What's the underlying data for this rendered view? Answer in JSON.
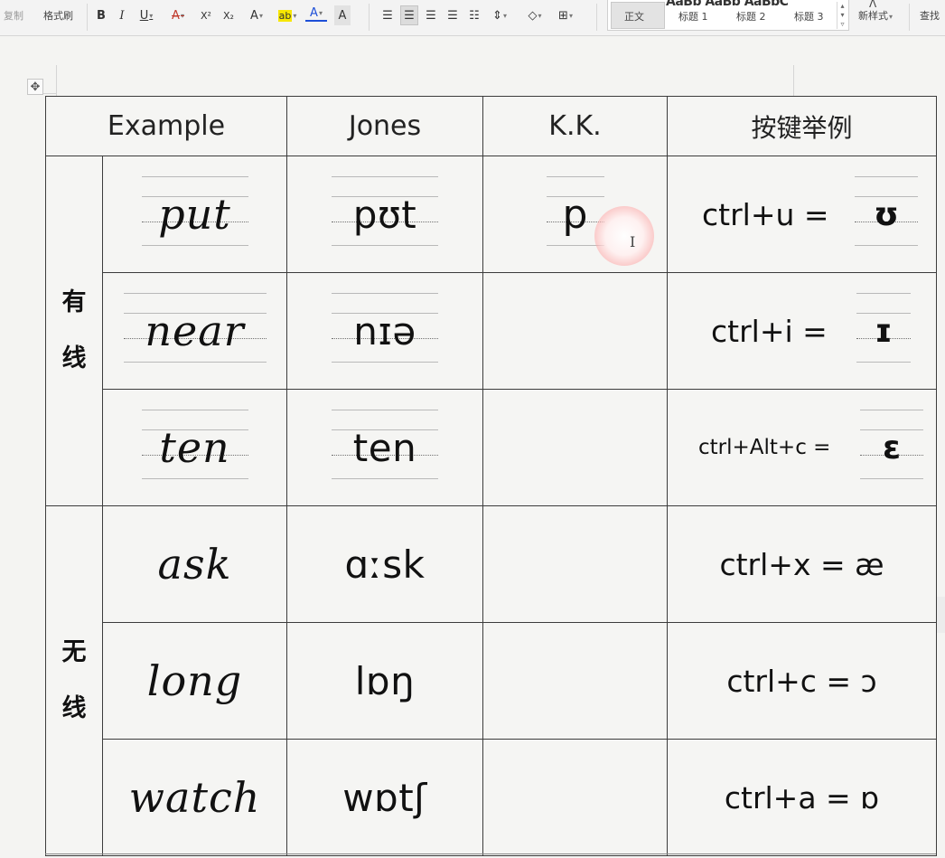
{
  "toolbar": {
    "copy_label": "复制",
    "format_painter_label": "格式刷",
    "bold": "B",
    "italic": "I",
    "underline": "U",
    "strike": "A",
    "superscript": "X²",
    "subscript": "X₂",
    "font_color_a": "A",
    "highlight": "ab",
    "font_color": "A",
    "char_shade": "A",
    "styles": {
      "preview": "AaBb AaBb AaBbC",
      "items": [
        "正文",
        "标题 1",
        "标题 2",
        "标题 3"
      ]
    },
    "new_style_label": "新样式",
    "find_label": "查找"
  },
  "table": {
    "headers": [
      "Example",
      "Jones",
      "K.K.",
      "按键举例"
    ],
    "groups": [
      {
        "label_chars": [
          "有",
          "线"
        ],
        "rows": [
          {
            "example": "put",
            "jones": "pʊt",
            "kk": "p",
            "shortcut": "ctrl+u =",
            "symbol": "ʊ"
          },
          {
            "example": "near",
            "jones": "nɪə",
            "kk": "",
            "shortcut": "ctrl+i =",
            "symbol": "ɪ"
          },
          {
            "example": "ten",
            "jones": "ten",
            "kk": "",
            "shortcut": "ctrl+Alt+c =",
            "symbol": "ɛ"
          }
        ]
      },
      {
        "label_chars": [
          "无",
          "线"
        ],
        "rows": [
          {
            "example": "ask",
            "jones": "ɑːsk",
            "kk": "",
            "shortcut": "ctrl+x = æ"
          },
          {
            "example": "long",
            "jones": "lɒŋ",
            "kk": "",
            "shortcut": "ctrl+c = ɔ"
          },
          {
            "example": "watch",
            "jones": "wɒtʃ",
            "kk": "",
            "shortcut": "ctrl+a = ɒ"
          }
        ]
      }
    ]
  }
}
